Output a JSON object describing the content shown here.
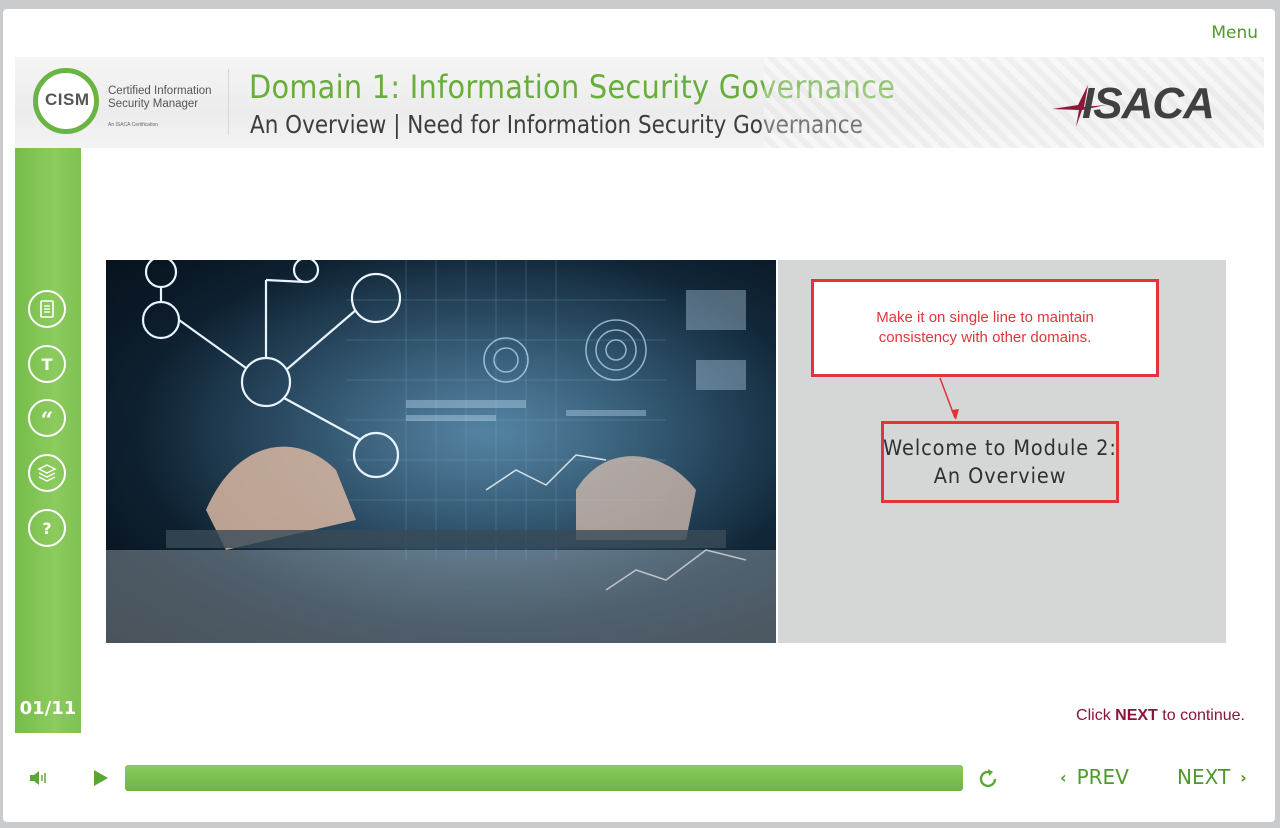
{
  "app": {
    "menu_label": "Menu"
  },
  "header": {
    "logo_name": "CISM",
    "logo_line1": "Certified Information",
    "logo_line2": "Security Manager",
    "logo_tagline": "An ISACA Certification",
    "title": "Domain 1: Information Security Governance",
    "subtitle": "An Overview | Need for Information Security Governance",
    "brand": "ISACA"
  },
  "sidebar": {
    "items": [
      {
        "name": "notes-icon"
      },
      {
        "name": "transcript-icon"
      },
      {
        "name": "quote-icon"
      },
      {
        "name": "resources-icon"
      },
      {
        "name": "help-icon"
      }
    ],
    "page_counter": "01/11"
  },
  "content": {
    "hero_image": "circuit-tablet-image",
    "review_note": "Make it on single line to maintain consistency with other domains.",
    "welcome_line1": "Welcome to Module 2:",
    "welcome_line2": "An Overview",
    "continue_prefix": "Click ",
    "continue_bold": "NEXT",
    "continue_suffix": " to continue."
  },
  "player": {
    "audio_icon": "speaker-icon",
    "play_icon": "play-icon",
    "progress": 1.0,
    "replay_icon": "replay-icon",
    "prev_label": "PREV",
    "next_label": "NEXT"
  },
  "colors": {
    "accent_green": "#6ab443",
    "annotation_red": "#e0353b",
    "continue_text": "#8a1538"
  }
}
